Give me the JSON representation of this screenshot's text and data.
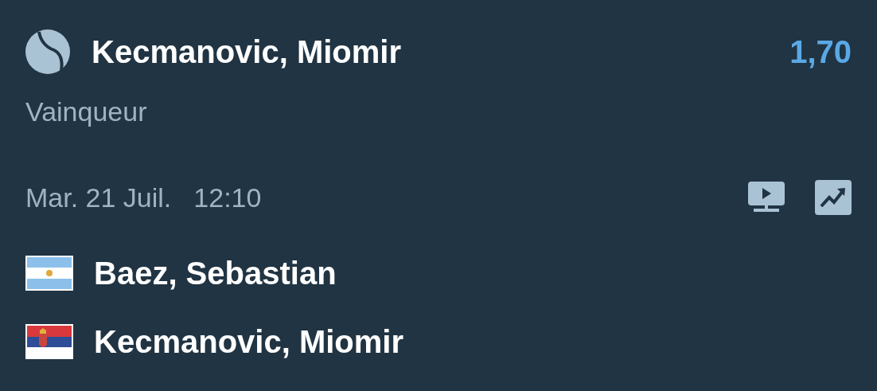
{
  "selection": {
    "name": "Kecmanovic, Miomir",
    "odds": "1,70"
  },
  "market": "Vainqueur",
  "event": {
    "date": "Mar. 21 Juil.",
    "time": "12:10"
  },
  "players": [
    {
      "name": "Baez, Sebastian",
      "kind": "argentina"
    },
    {
      "name": "Kecmanovic, Miomir",
      "kind": "serbia"
    }
  ]
}
